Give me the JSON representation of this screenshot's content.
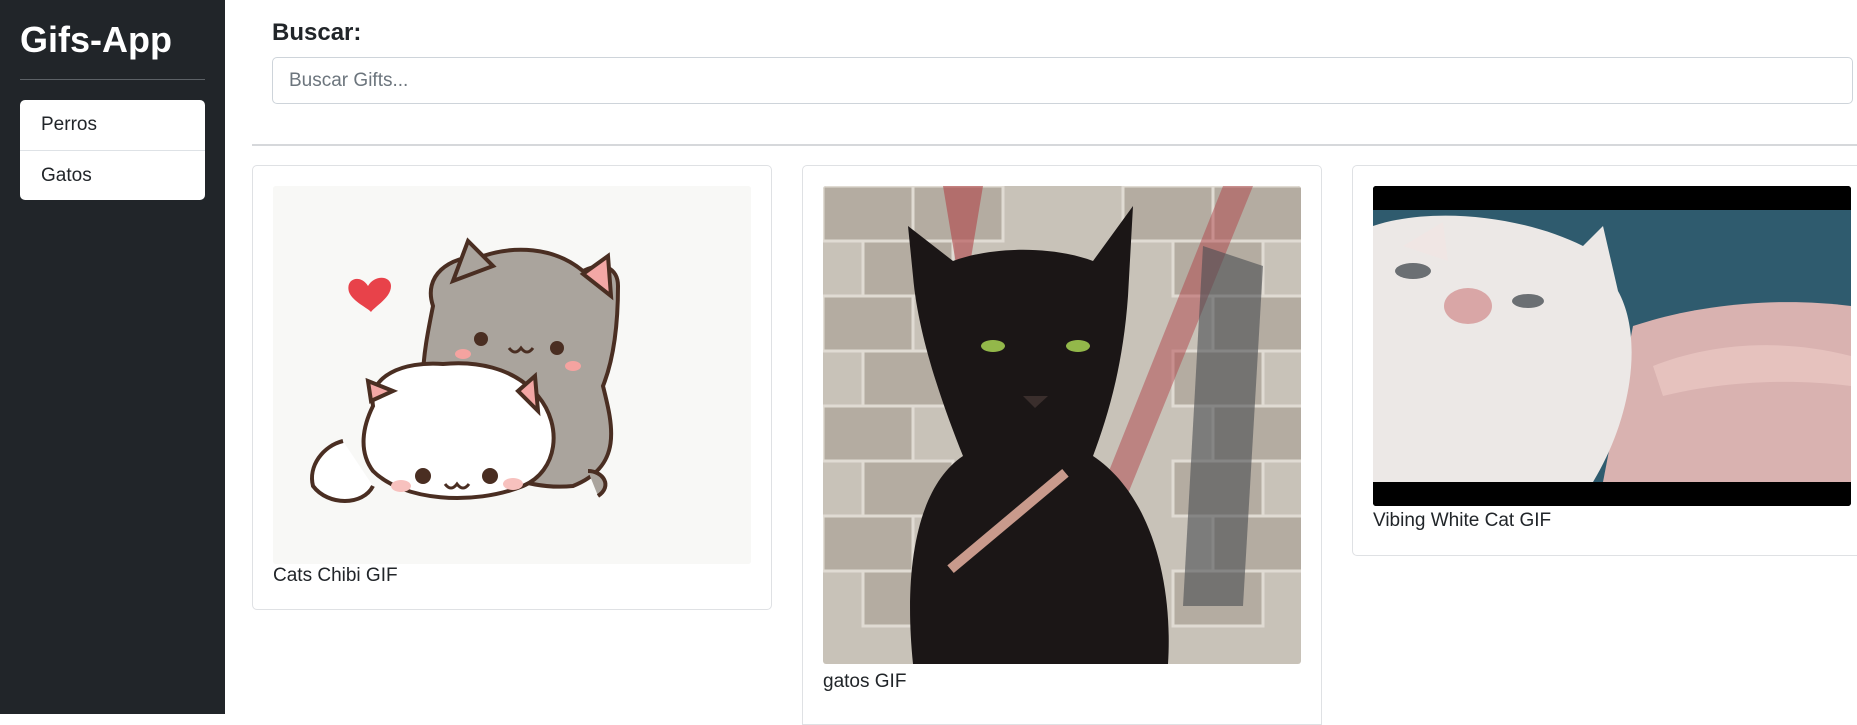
{
  "sidebar": {
    "brand": "Gifs-App",
    "history": [
      {
        "label": "Perros"
      },
      {
        "label": "Gatos"
      }
    ]
  },
  "search": {
    "label": "Buscar:",
    "placeholder": "Buscar Gifts...",
    "value": ""
  },
  "gifs": [
    {
      "title": "Cats Chibi GIF"
    },
    {
      "title": "gatos GIF"
    },
    {
      "title": "Vibing White Cat GIF"
    }
  ],
  "colors": {
    "sidebar_bg": "#212529",
    "text": "#212529",
    "border": "#dee2e6"
  }
}
